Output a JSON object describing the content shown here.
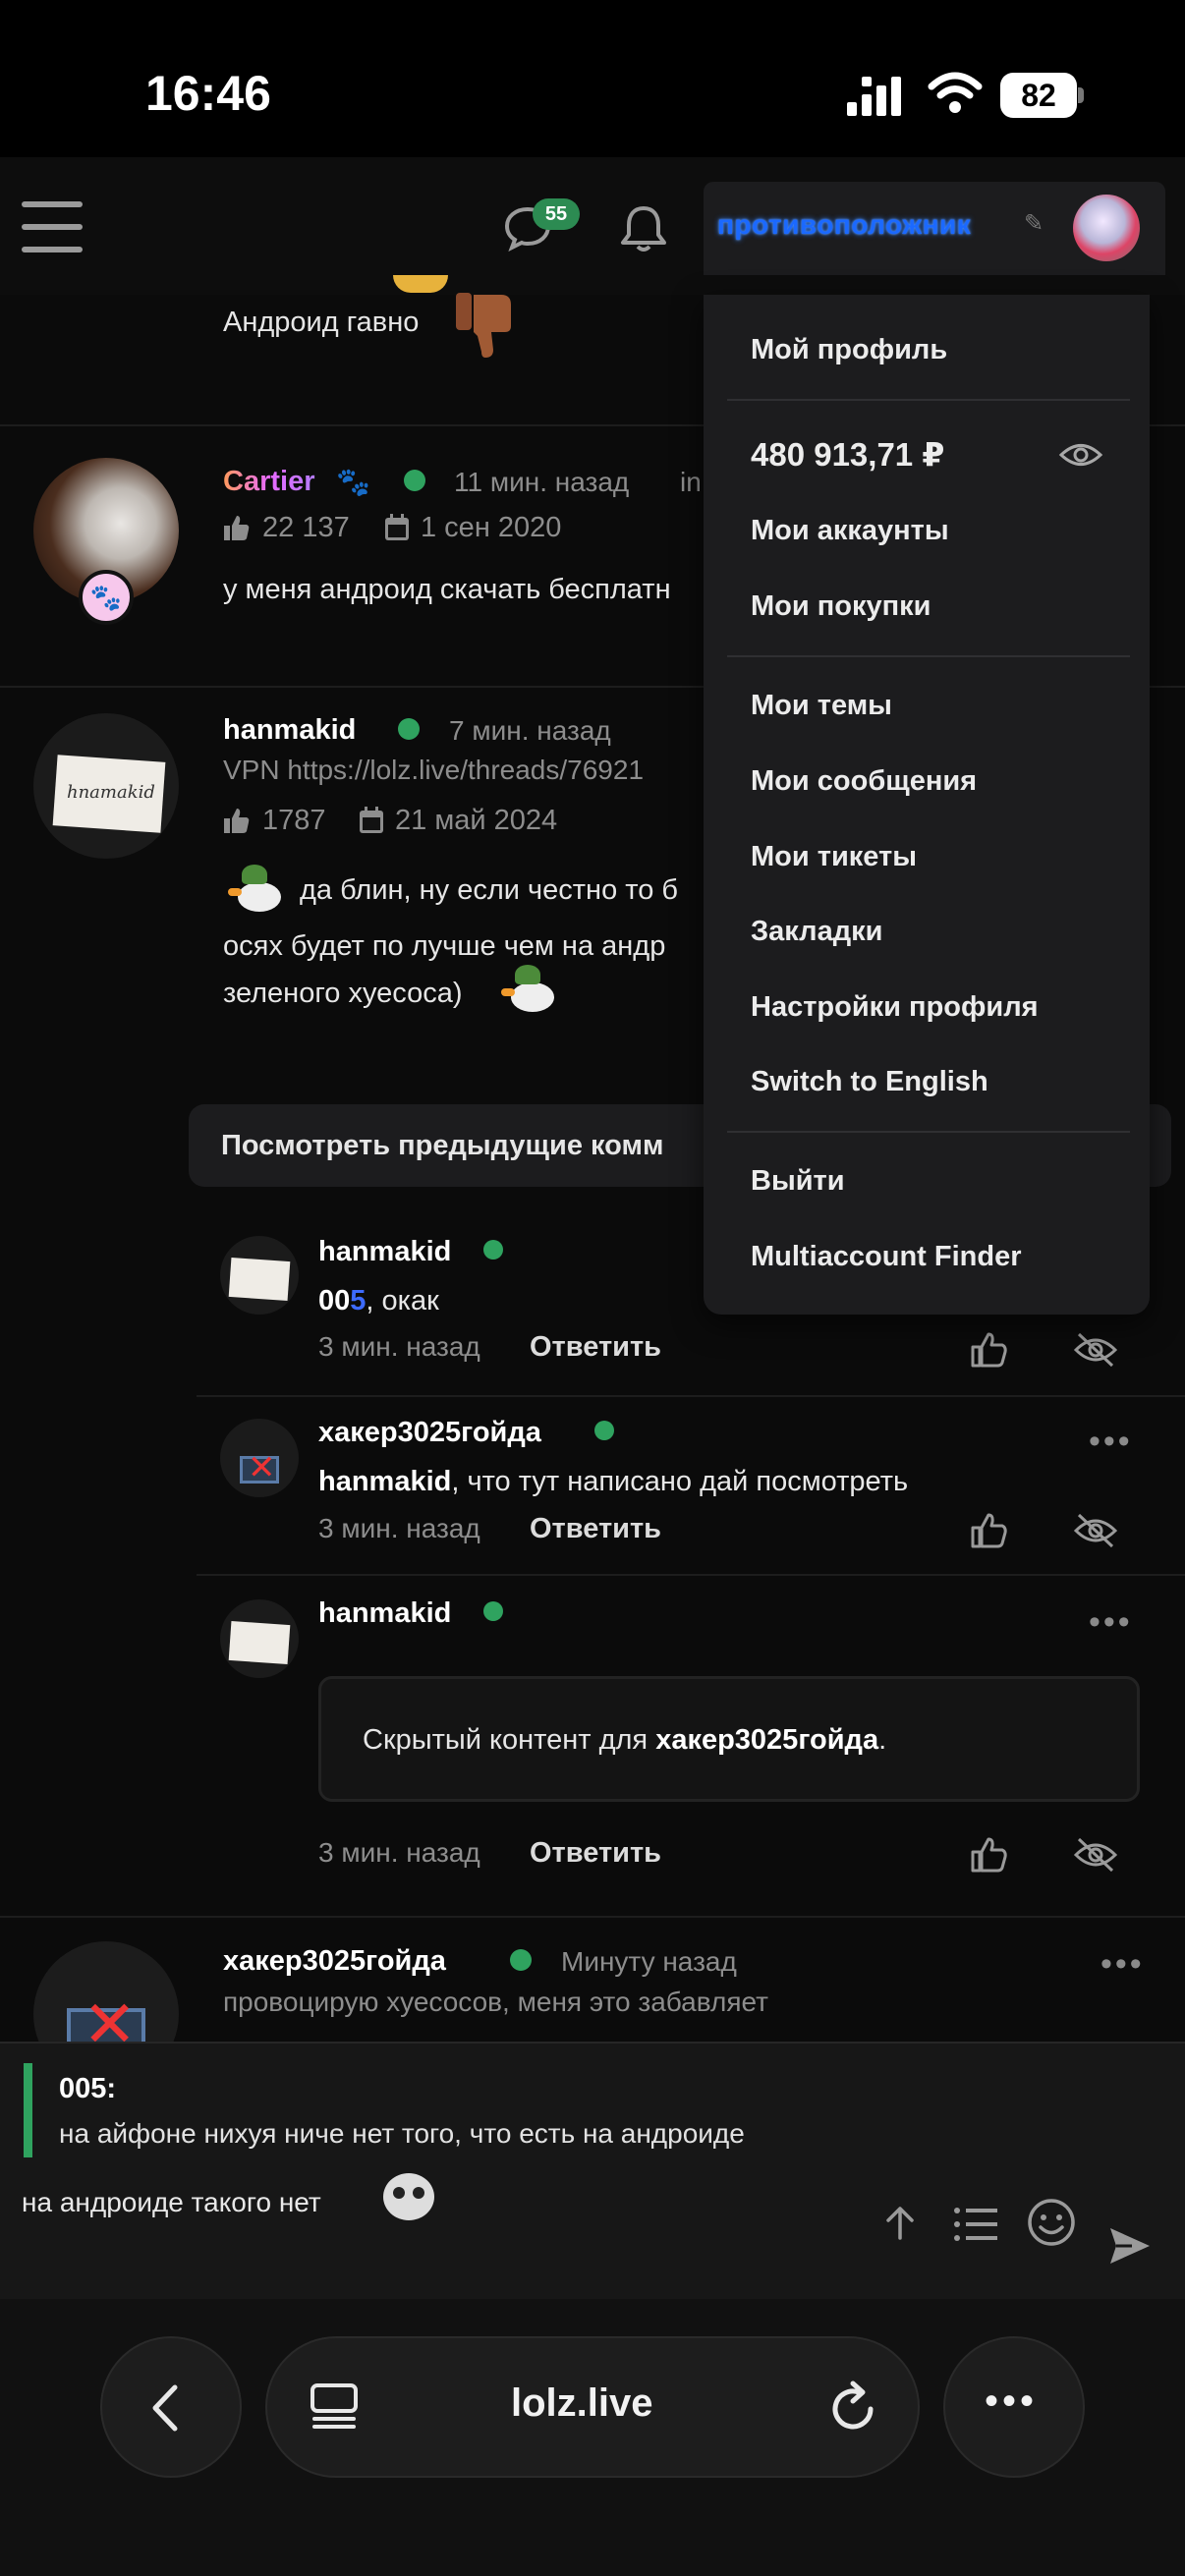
{
  "status_bar": {
    "time": "16:46",
    "battery": "82"
  },
  "header": {
    "chat_badge": "55",
    "username": "противоположник"
  },
  "dropdown": {
    "profile": "Мой профиль",
    "balance": "480 913,71 ₽",
    "accounts": "Мои аккаунты",
    "purchases": "Мои покупки",
    "threads": "Мои темы",
    "messages": "Мои сообщения",
    "tickets": "Мои тикеты",
    "bookmarks": "Закладки",
    "settings": "Настройки профиля",
    "language": "Switch to English",
    "logout": "Выйти",
    "multiaccount": "Multiaccount Finder"
  },
  "posts": [
    {
      "text": "Андроид гавно"
    },
    {
      "name": "Cartier",
      "time": "11 мин. назад",
      "tag": "in",
      "likes": "22 137",
      "date": "1 сен 2020",
      "text": "у меня андроид скачать бесплатн"
    },
    {
      "name": "hanmakid",
      "time": "7 мин. назад",
      "subtitle": "VPN https://lolz.live/threads/76921",
      "likes": "1787",
      "date": "21 май 2024",
      "line1": "да блин, ну если честно то б",
      "line2": "осях будет по лучше чем на андр",
      "line3": "зеленого хуесоса)"
    }
  ],
  "view_previous": "Посмотреть предыдущие комм",
  "comments": [
    {
      "name": "hanmakid",
      "mention_prefix": "00",
      "mention_digit": "5",
      "text": ", окак",
      "time": "3 мин. назад",
      "reply": "Ответить"
    },
    {
      "name": "хакер3025гойда",
      "mention": "hanmakid",
      "text": ", что тут написано дай посмотреть",
      "time": "3 мин. назад",
      "reply": "Ответить"
    },
    {
      "name": "hanmakid",
      "hidden_prefix": "Скрытый контент для ",
      "hidden_user": "хакер3025гойда",
      "hidden_suffix": ".",
      "time": "3 мин. назад",
      "reply": "Ответить"
    }
  ],
  "last_post": {
    "name": "хакер3025гойда",
    "time": "Минуту назад",
    "subtitle": "провоцирую хуесосов, меня это забавляет"
  },
  "reply_box": {
    "quote_author": "005:",
    "quote_text": "на айфоне нихуя ниче нет того, что есть на андроиде",
    "text": "на андроиде такого нет"
  },
  "browser": {
    "url": "lolz.live"
  },
  "colors": {
    "accent_green": "#2fa35f",
    "username_blue": "#1b69ff",
    "mention_blue": "#3d6bff"
  }
}
